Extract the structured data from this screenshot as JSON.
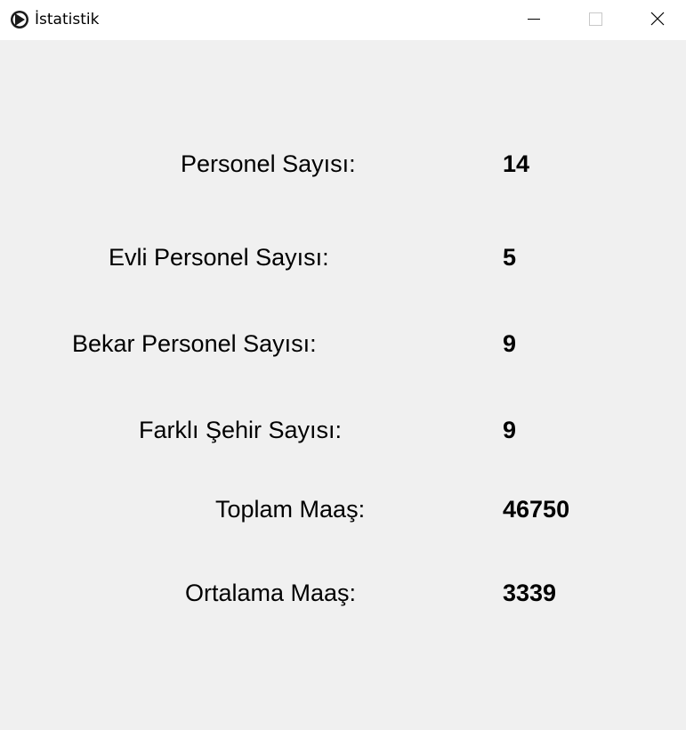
{
  "window": {
    "title": "İstatistik",
    "icon": "app-icon"
  },
  "stats": [
    {
      "label": "Personel Sayısı:",
      "value": "14"
    },
    {
      "label": "Evli Personel Sayısı:",
      "value": "5"
    },
    {
      "label": "Bekar Personel Sayısı:",
      "value": "9"
    },
    {
      "label": "Farklı Şehir Sayısı:",
      "value": "9"
    },
    {
      "label": "Toplam Maaş:",
      "value": "46750"
    },
    {
      "label": "Ortalama Maaş:",
      "value": "3339"
    }
  ]
}
